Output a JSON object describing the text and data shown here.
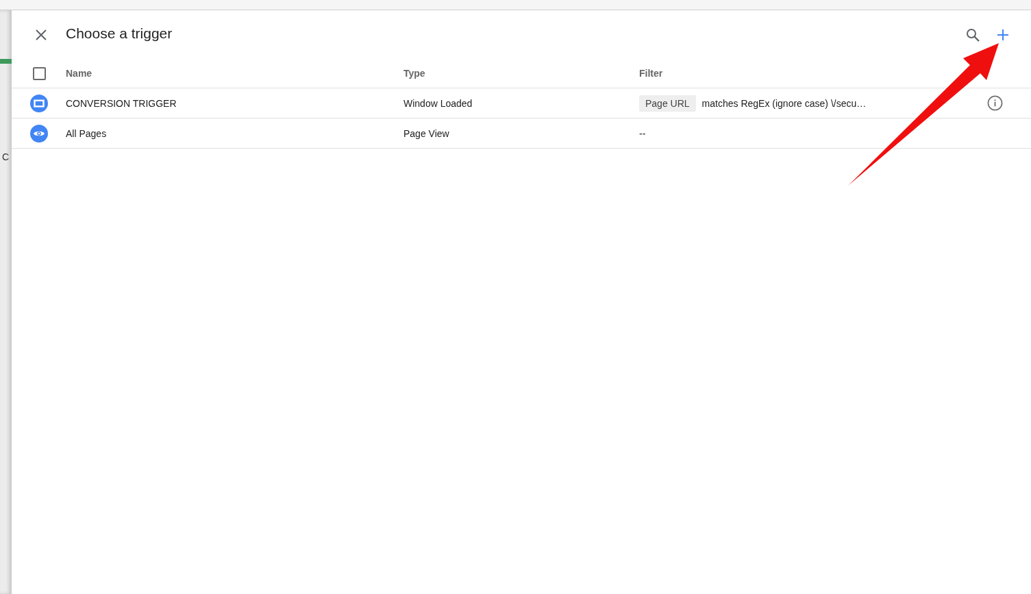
{
  "background_page": {
    "text_fragment": "C"
  },
  "dialog": {
    "title": "Choose a trigger"
  },
  "table": {
    "select_all": {
      "checked": false
    },
    "columns": [
      {
        "label": "Name"
      },
      {
        "label": "Type"
      },
      {
        "label": "Filter"
      }
    ],
    "rows": [
      {
        "kind": "window",
        "name": "CONVERSION TRIGGER",
        "type": "Window Loaded",
        "filter": {
          "variable": "Page URL",
          "condition": "matches RegEx (ignore case) \\/secu…"
        },
        "info": true
      },
      {
        "kind": "pageview",
        "name": "All Pages",
        "type": "Page View",
        "filter": {
          "condition": "--"
        },
        "info": false
      }
    ]
  }
}
